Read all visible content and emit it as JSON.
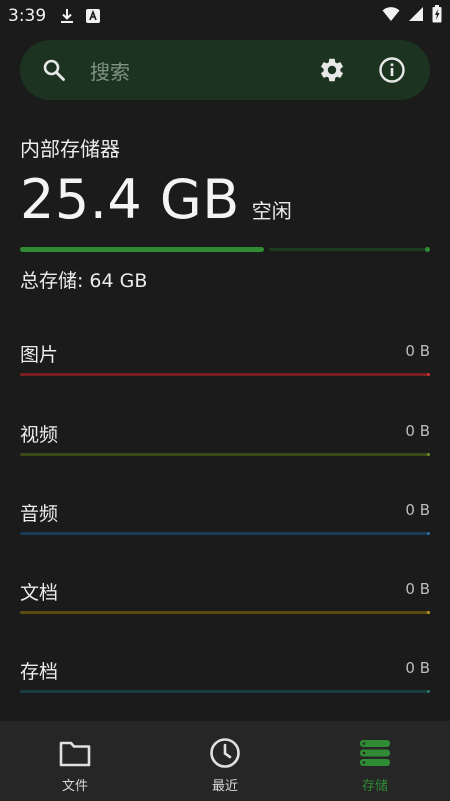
{
  "status_bar": {
    "time": "3:39"
  },
  "search": {
    "placeholder": "搜索"
  },
  "storage": {
    "title": "内部存储器",
    "free_value": "25.4 GB",
    "free_label": "空闲",
    "used_fraction": 0.603,
    "total_label": "总存储:",
    "total_value": "64 GB"
  },
  "categories": [
    {
      "name": "图片",
      "size": "0 B",
      "color": "#7a1f1f",
      "dot": "#c93232"
    },
    {
      "name": "视频",
      "size": "0 B",
      "color": "#3b4a17",
      "dot": "#6c8a26"
    },
    {
      "name": "音频",
      "size": "0 B",
      "color": "#1b3a57",
      "dot": "#2b6ea3"
    },
    {
      "name": "文档",
      "size": "0 B",
      "color": "#5a4b12",
      "dot": "#b8951f"
    },
    {
      "name": "存档",
      "size": "0 B",
      "color": "#173f3f",
      "dot": "#2a7474"
    }
  ],
  "bottom_nav": [
    {
      "label": "文件",
      "icon": "folder-icon"
    },
    {
      "label": "最近",
      "icon": "clock-icon"
    },
    {
      "label": "存储",
      "icon": "storage-icon",
      "active": true
    }
  ],
  "colors": {
    "accent": "#2f8c34",
    "background": "#1b1b1b",
    "search_bar": "#1c3320",
    "nav_bar": "#262626"
  }
}
